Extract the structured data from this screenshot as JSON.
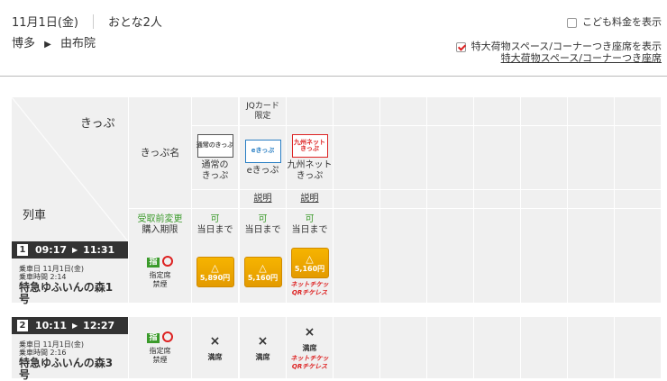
{
  "header": {
    "date": "11月1日(金)",
    "passengers": "おとな2人",
    "from": "博多",
    "arrow": "▶",
    "to": "由布院"
  },
  "options": {
    "child_fare": "こども料金を表示",
    "child_checked": false,
    "large_luggage": "特大荷物スペース/コーナーつき座席を表示",
    "large_checked": true,
    "large_link": "特大荷物スペース/コーナーつき座席"
  },
  "table": {
    "corner_ticket": "きっぷ",
    "corner_train": "列車",
    "ticket_name_label": "きっぷ名",
    "change_label": "受取前変更",
    "deadline_label": "購入期限",
    "tickets": [
      {
        "badge": "",
        "logo": "通常のきっぷ",
        "name": "通常の\nきっぷ",
        "info": "",
        "change": "可",
        "deadline": "当日まで"
      },
      {
        "badge": "JQカード\n限定",
        "logo": "eきっぷ",
        "name": "eきっぷ",
        "info": "説明",
        "change": "可",
        "deadline": "当日まで"
      },
      {
        "badge": "",
        "logo": "九州ネット\nきっぷ",
        "name": "九州ネット\nきっぷ",
        "info": "説明",
        "change": "可",
        "deadline": "当日まで"
      }
    ]
  },
  "trains": [
    {
      "no": "1",
      "dep": "09:17",
      "arr": "11:31",
      "date": "乗車日 11月1日(金)",
      "duration": "乗車時間 2:14",
      "name": "特急ゆふいんの森1号",
      "seat_icon": "指",
      "seat": "指定席",
      "smoke": "禁煙",
      "fares": [
        {
          "mark": "△",
          "price": "5,890円"
        },
        {
          "mark": "△",
          "price": "5,160円"
        },
        {
          "mark": "△",
          "price": "5,160円",
          "qr": "ネットチケッ QRチケレス"
        }
      ]
    },
    {
      "no": "2",
      "dep": "10:11",
      "arr": "12:27",
      "date": "乗車日 11月1日(金)",
      "duration": "乗車時間 2:16",
      "name": "特急ゆふいんの森3号",
      "seat_icon": "指",
      "seat": "指定席",
      "smoke": "禁煙",
      "fares": [
        {
          "mark": "×",
          "price": "満席"
        },
        {
          "mark": "×",
          "price": "満席"
        },
        {
          "mark": "×",
          "price": "満席",
          "qr": "ネットチケッ QRチケレス"
        }
      ]
    }
  ]
}
